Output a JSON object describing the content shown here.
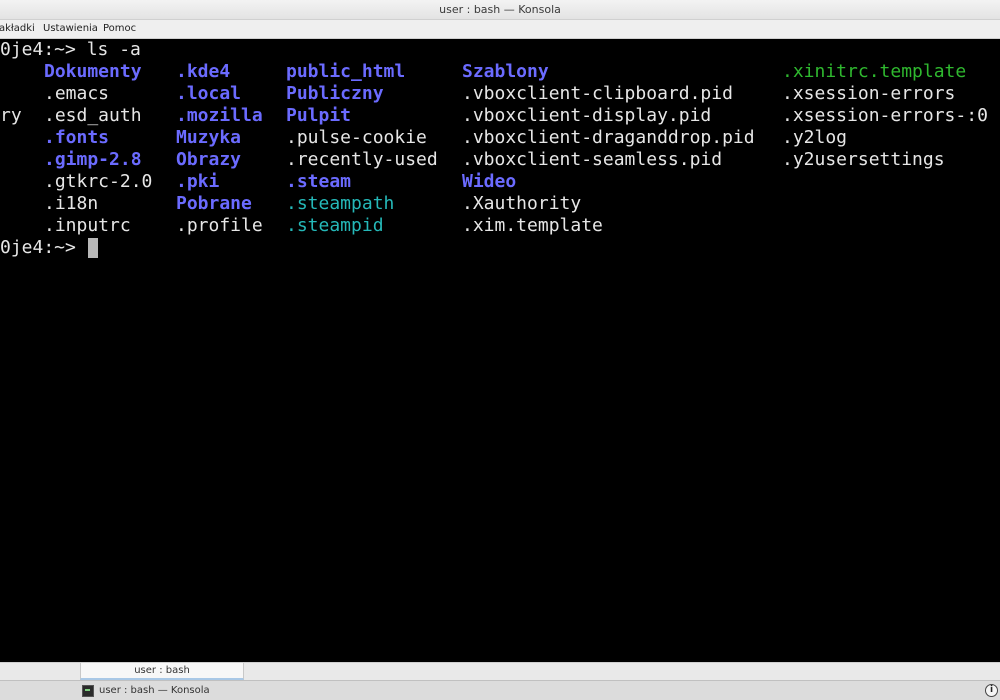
{
  "window": {
    "title": "user : bash — Konsola"
  },
  "menubar": {
    "items": [
      "akładki",
      "Ustawienia",
      "Pomoc"
    ]
  },
  "terminal": {
    "prompt_1": "0je4:~>",
    "command": " ls -a",
    "prompt_2": "0je4:~>",
    "columns": [
      {
        "items": [
          {
            "text": "",
            "type": "plain"
          },
          {
            "text": "",
            "type": "plain"
          },
          {
            "text": "ry",
            "type": "plain"
          },
          {
            "text": "",
            "type": "plain"
          },
          {
            "text": "",
            "type": "plain"
          },
          {
            "text": "",
            "type": "plain"
          },
          {
            "text": "",
            "type": "plain"
          },
          {
            "text": "",
            "type": "plain"
          }
        ]
      },
      {
        "items": [
          {
            "text": "Dokumenty",
            "type": "dir"
          },
          {
            "text": ".emacs",
            "type": "plain"
          },
          {
            "text": ".esd_auth",
            "type": "plain"
          },
          {
            "text": ".fonts",
            "type": "dir"
          },
          {
            "text": ".gimp-2.8",
            "type": "dir"
          },
          {
            "text": ".gtkrc-2.0",
            "type": "plain"
          },
          {
            "text": ".i18n",
            "type": "plain"
          },
          {
            "text": ".inputrc",
            "type": "plain"
          }
        ]
      },
      {
        "items": [
          {
            "text": ".kde4",
            "type": "dir"
          },
          {
            "text": ".local",
            "type": "dir"
          },
          {
            "text": ".mozilla",
            "type": "dir"
          },
          {
            "text": "Muzyka",
            "type": "dir"
          },
          {
            "text": "Obrazy",
            "type": "dir"
          },
          {
            "text": ".pki",
            "type": "dir"
          },
          {
            "text": "Pobrane",
            "type": "dir"
          },
          {
            "text": ".profile",
            "type": "plain"
          }
        ]
      },
      {
        "items": [
          {
            "text": "public_html",
            "type": "dir"
          },
          {
            "text": "Publiczny",
            "type": "dir"
          },
          {
            "text": "Pulpit",
            "type": "dir"
          },
          {
            "text": ".pulse-cookie",
            "type": "plain"
          },
          {
            "text": ".recently-used",
            "type": "plain"
          },
          {
            "text": ".steam",
            "type": "dir"
          },
          {
            "text": ".steampath",
            "type": "cyan"
          },
          {
            "text": ".steampid",
            "type": "cyan"
          }
        ]
      },
      {
        "items": [
          {
            "text": "Szablony",
            "type": "dir"
          },
          {
            "text": ".vboxclient-clipboard.pid",
            "type": "plain"
          },
          {
            "text": ".vboxclient-display.pid",
            "type": "plain"
          },
          {
            "text": ".vboxclient-draganddrop.pid",
            "type": "plain"
          },
          {
            "text": ".vboxclient-seamless.pid",
            "type": "plain"
          },
          {
            "text": "Wideo",
            "type": "dir"
          },
          {
            "text": ".Xauthority",
            "type": "plain"
          },
          {
            "text": ".xim.template",
            "type": "plain"
          }
        ]
      },
      {
        "items": [
          {
            "text": ".xinitrc.template",
            "type": "green"
          },
          {
            "text": ".xsession-errors",
            "type": "plain"
          },
          {
            "text": ".xsession-errors-:0",
            "type": "plain"
          },
          {
            "text": ".y2log",
            "type": "plain"
          },
          {
            "text": ".y2usersettings",
            "type": "plain"
          },
          {
            "text": "",
            "type": "plain"
          },
          {
            "text": "",
            "type": "plain"
          },
          {
            "text": "",
            "type": "plain"
          }
        ]
      }
    ]
  },
  "tabbar": {
    "active_tab": "user : bash"
  },
  "taskbar": {
    "task_label": "user : bash — Konsola",
    "tray_icon": "update-icon",
    "tray_glyph": "i"
  },
  "colors": {
    "directory": "#6b6bff",
    "link": "#25b8b8",
    "executable": "#2fb82f",
    "text": "#e6e6e6",
    "background": "#000000"
  }
}
